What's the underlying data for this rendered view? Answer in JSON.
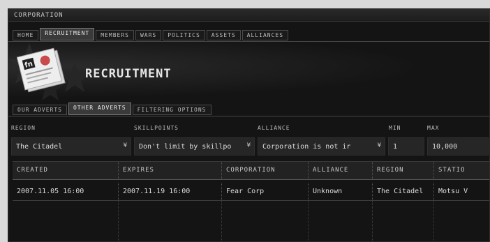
{
  "window": {
    "title": "CORPORATION"
  },
  "main_tabs": [
    {
      "label": "HOME",
      "active": false
    },
    {
      "label": "RECRUITMENT",
      "active": true
    },
    {
      "label": "MEMBERS",
      "active": false
    },
    {
      "label": "WARS",
      "active": false
    },
    {
      "label": "POLITICS",
      "active": false
    },
    {
      "label": "ASSETS",
      "active": false
    },
    {
      "label": "ALLIANCES",
      "active": false
    }
  ],
  "header": {
    "title": "RECRUITMENT"
  },
  "sub_tabs": [
    {
      "label": "OUR ADVERTS",
      "active": false
    },
    {
      "label": "OTHER ADVERTS",
      "active": true
    },
    {
      "label": "FILTERING OPTIONS",
      "active": false
    }
  ],
  "filters": {
    "labels": {
      "region": "REGION",
      "skillpoints": "SKILLPOINTS",
      "alliance": "ALLIANCE",
      "min": "MIN",
      "max": "MAX"
    },
    "region": "The Citadel",
    "skillpoints": "Don't limit by skillpo",
    "alliance": "Corporation is not ir",
    "min": "1",
    "max": "10,000",
    "arrow": "¥"
  },
  "table": {
    "columns": [
      "CREATED",
      "EXPIRES",
      "CORPORATION",
      "ALLIANCE",
      "REGION",
      "STATIO"
    ],
    "rows": [
      [
        "2007.11.05 16:00",
        "2007.11.19 16:00",
        "Fear Corp",
        "Unknown",
        "The Citadel",
        "Motsu V"
      ]
    ]
  },
  "icons": {
    "logo": "corporation-document-icon",
    "stars": "eve-star-emblem-icon"
  }
}
